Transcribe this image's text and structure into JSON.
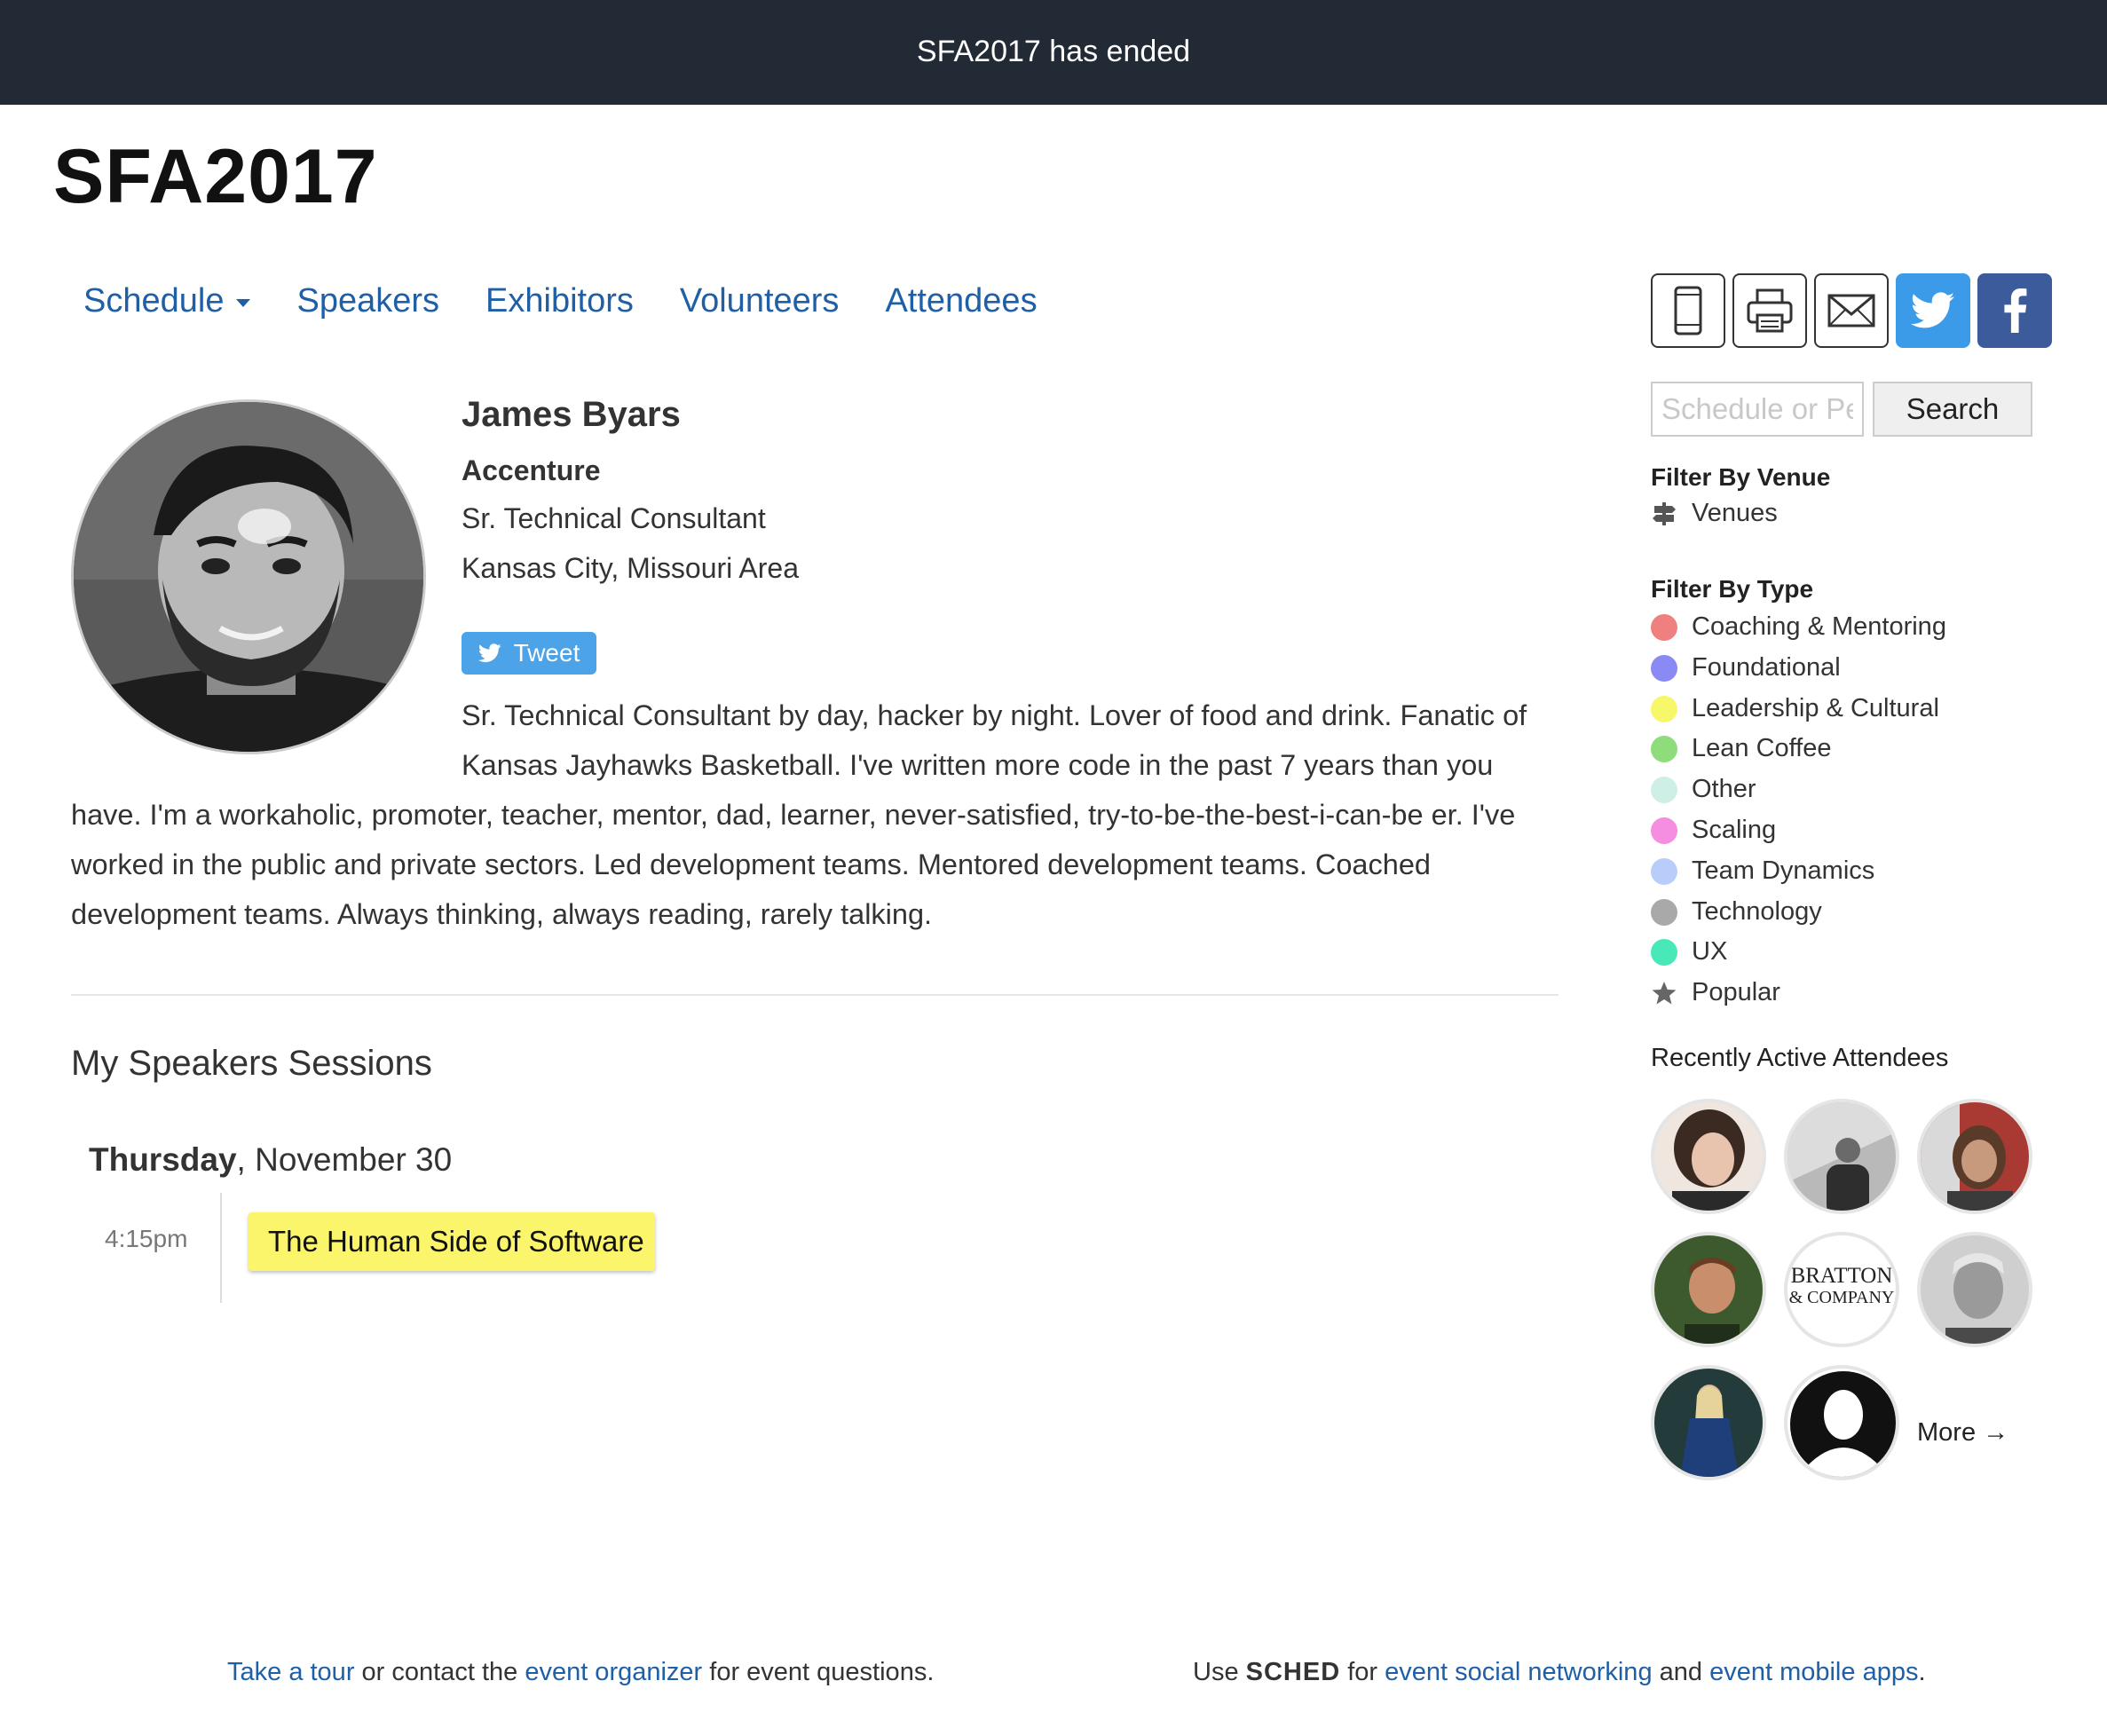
{
  "banner": {
    "event": "SFA2017",
    "status": "has ended"
  },
  "site_title": "SFA2017",
  "nav": {
    "schedule": "Schedule",
    "speakers": "Speakers",
    "exhibitors": "Exhibitors",
    "volunteers": "Volunteers",
    "attendees": "Attendees"
  },
  "search": {
    "placeholder": "Schedule or People",
    "button": "Search"
  },
  "filters": {
    "venue_title": "Filter By Venue",
    "venues_label": "Venues",
    "type_title": "Filter By Type",
    "types": [
      {
        "label": "Coaching & Mentoring",
        "color": "#f08080"
      },
      {
        "label": "Foundational",
        "color": "#8a8af5"
      },
      {
        "label": "Leadership & Cultural",
        "color": "#f7f76a"
      },
      {
        "label": "Lean Coffee",
        "color": "#8fdc7a"
      },
      {
        "label": "Other",
        "color": "#cdefe6"
      },
      {
        "label": "Scaling",
        "color": "#f58de0"
      },
      {
        "label": "Team Dynamics",
        "color": "#b9cdfb"
      },
      {
        "label": "Technology",
        "color": "#a9a9a9"
      },
      {
        "label": "UX",
        "color": "#48e8b8"
      }
    ],
    "popular_label": "Popular"
  },
  "recent": {
    "title": "Recently Active Attendees",
    "more": "More →",
    "logo_line1": "BRATTON",
    "logo_line2": "& COMPANY"
  },
  "speaker": {
    "name": "James Byars",
    "company": "Accenture",
    "position": "Sr. Technical Consultant",
    "location": "Kansas City, Missouri Area",
    "tweet_label": "Tweet",
    "bio": "Sr. Technical Consultant by day, hacker by night. Lover of food and drink. Fanatic of Kansas Jayhawks Basketball. I've written more code in the past 7 years than you have. I'm a workaholic, promoter, teacher, mentor, dad, learner, never-satisfied, try-to-be-the-best-i-can-be er. I've worked in the public and private sectors. Led development teams. Mentored development teams. Coached development teams. Always thinking, always reading, rarely talking."
  },
  "sessions": {
    "title": "My Speakers Sessions",
    "day_name": "Thursday",
    "date": ", November 30",
    "items": [
      {
        "time": "4:15pm",
        "title": "The Human Side of Software"
      }
    ]
  },
  "footer": {
    "tour": "Take a tour",
    "contact": " or contact the ",
    "organizer": "event organizer",
    "questions": " for event questions.",
    "use": "Use ",
    "sched": "SCHED",
    "for": " for ",
    "social": "event social networking",
    "and": " and ",
    "apps": "event mobile apps",
    "period": "."
  },
  "colors": {
    "banner_bg": "#222a35",
    "link": "#1f5fa6",
    "session_card": "#faf56a",
    "twitter": "#3c9be8",
    "facebook": "#3b5b9a"
  }
}
